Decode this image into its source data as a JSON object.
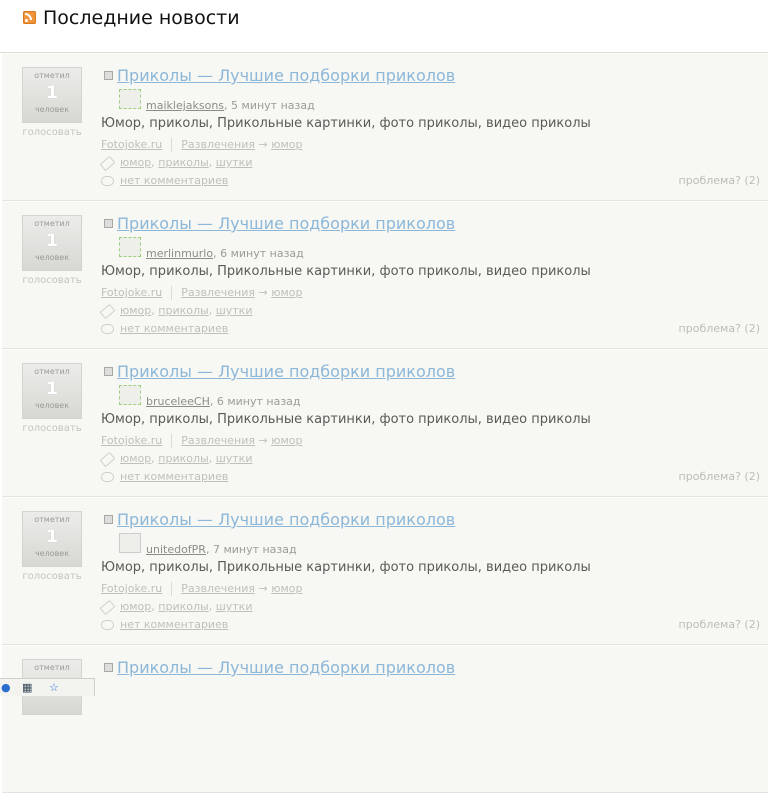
{
  "header": {
    "title": "Последние новости",
    "icon": "rss-icon"
  },
  "items": [
    {
      "vote_top": "отметил",
      "vote_count": "1",
      "vote_bottom": "человек",
      "vote_action": "голосовать",
      "title": "Приколы — Лучшие подборки приколов",
      "author": "maiklejaksons",
      "time": ", 5 минут назад",
      "description": "Юмор, приколы, Прикольные картинки, фото приколы, видео приколы",
      "source": "Fotojoke.ru",
      "category": "Развлечения",
      "arrow": " → ",
      "subcategory": "юмор",
      "tag1": "юмор",
      "tag2": "приколы",
      "tag3": "шутки",
      "comma": ", ",
      "comments": "нет комментариев",
      "problem": "проблема? (2)"
    },
    {
      "vote_top": "отметил",
      "vote_count": "1",
      "vote_bottom": "человек",
      "vote_action": "голосовать",
      "title": "Приколы — Лучшие подборки приколов",
      "author": "merlinmurlo",
      "time": ", 6 минут назад",
      "description": "Юмор, приколы, Прикольные картинки, фото приколы, видео приколы",
      "source": "Fotojoke.ru",
      "category": "Развлечения",
      "arrow": " → ",
      "subcategory": "юмор",
      "tag1": "юмор",
      "tag2": "приколы",
      "tag3": "шутки",
      "comma": ", ",
      "comments": "нет комментариев",
      "problem": "проблема? (2)"
    },
    {
      "vote_top": "отметил",
      "vote_count": "1",
      "vote_bottom": "человек",
      "vote_action": "голосовать",
      "title": "Приколы — Лучшие подборки приколов",
      "author": "bruceleeCH",
      "time": ", 6 минут назад",
      "description": "Юмор, приколы, Прикольные картинки, фото приколы, видео приколы",
      "source": "Fotojoke.ru",
      "category": "Развлечения",
      "arrow": " → ",
      "subcategory": "юмор",
      "tag1": "юмор",
      "tag2": "приколы",
      "tag3": "шутки",
      "comma": ", ",
      "comments": "нет комментариев",
      "problem": "проблема? (2)"
    },
    {
      "vote_top": "отметил",
      "vote_count": "1",
      "vote_bottom": "человек",
      "vote_action": "голосовать",
      "title": "Приколы — Лучшие подборки приколов",
      "author": "unitedofPR",
      "time": ", 7 минут назад",
      "description": "Юмор, приколы, Прикольные картинки, фото приколы, видео приколы",
      "source": "Fotojoke.ru",
      "category": "Развлечения",
      "arrow": " → ",
      "subcategory": "юмор",
      "tag1": "юмор",
      "tag2": "приколы",
      "tag3": "шутки",
      "comma": ", ",
      "comments": "нет комментариев",
      "problem": "проблема? (2)"
    },
    {
      "vote_top": "отметил",
      "title": "Приколы — Лучшие подборки приколов"
    }
  ],
  "colors": {
    "link": "#8cb7d9",
    "background": "#f7f7f3",
    "rss": "#f0953a"
  }
}
